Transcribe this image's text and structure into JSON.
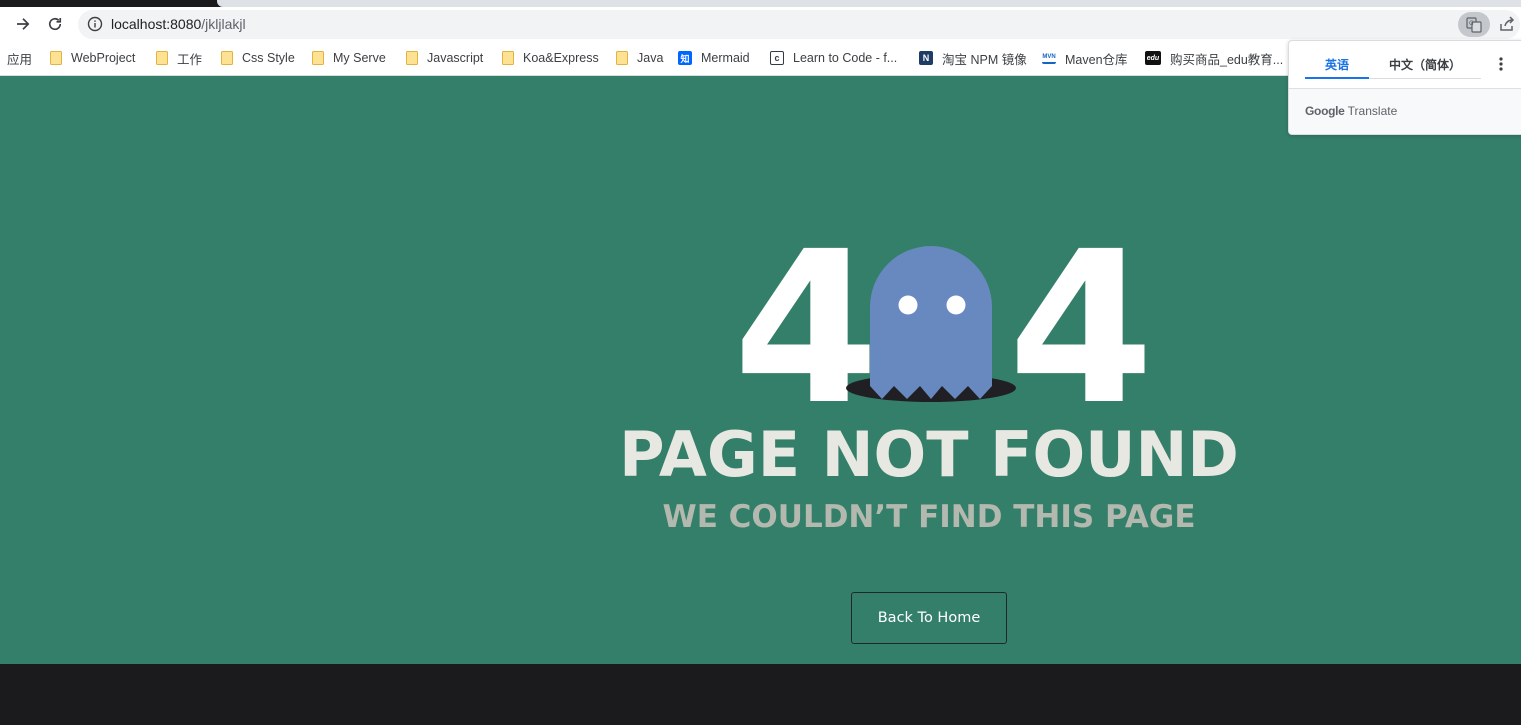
{
  "browser": {
    "url_host": "localhost:8080",
    "url_path": "/jkljlakjl"
  },
  "bookmarks": [
    {
      "label": "应用",
      "icon": "apps-icon"
    },
    {
      "label": "WebProject",
      "icon": "folder-icon"
    },
    {
      "label": "工作",
      "icon": "folder-icon"
    },
    {
      "label": "Css Style",
      "icon": "folder-icon"
    },
    {
      "label": "My Serve",
      "icon": "folder-icon"
    },
    {
      "label": "Javascript",
      "icon": "folder-icon"
    },
    {
      "label": "Koa&Express",
      "icon": "folder-icon"
    },
    {
      "label": "Java",
      "icon": "folder-icon"
    },
    {
      "label": "Mermaid",
      "icon": "zhihu-icon",
      "icon_text": "知",
      "color": "#0066ff"
    },
    {
      "label": "Learn to Code - f...",
      "icon": "freecodecamp-icon",
      "icon_text": "c",
      "color": "#2f3b4a"
    },
    {
      "label": "淘宝 NPM 镜像",
      "icon": "npm-mirror-icon",
      "icon_text": "N",
      "color": "#1f3c64"
    },
    {
      "label": "Maven仓库",
      "icon": "maven-icon",
      "icon_text": "MVN",
      "color": "#1565c0"
    },
    {
      "label": "购买商品_edu教育...",
      "icon": "edu-icon",
      "icon_text": "edu",
      "color": "#111111"
    }
  ],
  "translate_popup": {
    "tab_source": "英语",
    "tab_target": "中文（简体）",
    "brand_google": "Google",
    "brand_translate": "Translate"
  },
  "error_page": {
    "digit_left": "4",
    "digit_right": "4",
    "title": "PAGE NOT FOUND",
    "subtitle": "WE COULDN’T FIND THIS PAGE",
    "button_label": "Back To Home"
  },
  "colors": {
    "page_bg": "#347f6a",
    "ghost": "#6889c0",
    "footer": "#1b1b1d"
  }
}
